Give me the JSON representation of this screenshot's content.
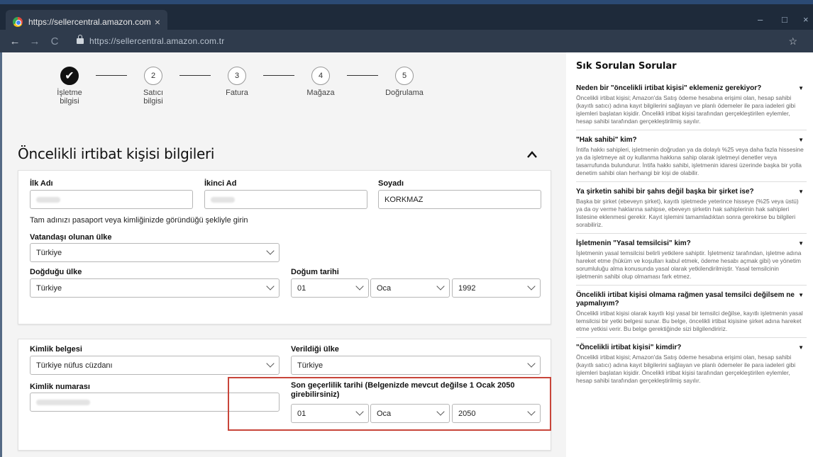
{
  "browser": {
    "tab_title": "https://sellercentral.amazon.com.tr",
    "tab_close": "×",
    "url": "https://sellercentral.amazon.com.tr",
    "minimize": "–",
    "maximize": "□",
    "close": "×",
    "back": "←",
    "forward": "→",
    "reload": "C",
    "bookmark": "☆"
  },
  "stepper": {
    "steps": [
      {
        "num": "✔",
        "label": "İşletme\nbilgisi",
        "state": "done"
      },
      {
        "num": "2",
        "label": "Satıcı\nbilgisi",
        "state": "todo"
      },
      {
        "num": "3",
        "label": "Fatura",
        "state": "todo"
      },
      {
        "num": "4",
        "label": "Mağaza",
        "state": "todo"
      },
      {
        "num": "5",
        "label": "Doğrulama",
        "state": "todo"
      }
    ]
  },
  "section": {
    "title": "Öncelikli irtibat kişisi bilgileri"
  },
  "form": {
    "first_name_label": "İlk Adı",
    "middle_name_label": "İkinci Ad",
    "last_name_label": "Soyadı",
    "last_name_value": "KORKMAZ",
    "name_hint": "Tam adınızı pasaport veya kimliğinizde göründüğü şekliyle girin",
    "citizenship_label": "Vatandaşı olunan ülke",
    "citizenship_value": "Türkiye",
    "birth_country_label": "Doğduğu ülke",
    "birth_country_value": "Türkiye",
    "birth_date_label": "Doğum tarihi",
    "birth_day": "01",
    "birth_month": "Oca",
    "birth_year": "1992",
    "id_doc_label": "Kimlik belgesi",
    "id_doc_value": "Türkiye nüfus cüzdanı",
    "issued_country_label": "Verildiği ülke",
    "issued_country_value": "Türkiye",
    "id_number_label": "Kimlik numarası",
    "expiry_label": "Son geçerlilik tarihi (Belgenizde mevcut değilse 1 Ocak 2050 girebilirsiniz)",
    "expiry_day": "01",
    "expiry_month": "Oca",
    "expiry_year": "2050"
  },
  "faq": {
    "heading": "Sık Sorulan Sorular",
    "items": [
      {
        "q": "Neden bir \"öncelikli irtibat kişisi\" eklemeniz gerekiyor?",
        "a": "Öncelikli irtibat kişisi; Amazon'da Satış ödeme hesabına erişimi olan, hesap sahibi (kayıtlı satıcı) adına kayıt bilgilerini sağlayan ve planlı ödemeler ile para iadeleri gibi işlemleri başlatan kişidir. Öncelikli irtibat kişisi tarafından gerçekleştirilen eylemler, hesap sahibi tarafından gerçekleştirilmiş sayılır."
      },
      {
        "q": "\"Hak sahibi\" kim?",
        "a": "İntifa hakkı sahipleri, işletmenin doğrudan ya da dolaylı %25 veya daha fazla hissesine ya da işletmeye ait oy kullanma hakkına sahip olarak işletmeyi denetler veya tasarrufunda bulundurur. İntifa hakkı sahibi, işletmenin idaresi üzerinde başka bir yolla denetim sahibi olan herhangi bir kişi de olabilir."
      },
      {
        "q": "Ya şirketin sahibi bir şahıs değil başka bir şirket ise?",
        "a": "Başka bir şirket (ebeveyn şirket), kayıtlı işletmede yeterince hisseye (%25 veya üstü) ya da oy verme haklarına sahipse, ebeveyn şirketin hak sahiplerinin hak sahipleri listesine eklenmesi gerekir. Kayıt işlemini tamamladıktan sonra gerekirse bu bilgileri sorabiliriz."
      },
      {
        "q": "İşletmenin \"Yasal temsilcisi\" kim?",
        "a": "İşletmenin yasal temsilcisi belirli yetkilere sahiptir. İşletmeniz tarafından, işletme adına hareket etme (hüküm ve koşulları kabul etmek, ödeme hesabı açmak gibi) ve yönetim sorumluluğu alma konusunda yasal olarak yetkilendirilmiştir. Yasal temsilcinin işletmenin sahibi olup olmaması fark etmez."
      },
      {
        "q": "Öncelikli irtibat kişisi olmama rağmen yasal temsilci değilsem ne yapmalıyım?",
        "a": "Öncelikli irtibat kişisi olarak kayıtlı kişi yasal bir temsilci değilse, kayıtlı işletmenin yasal temsilcisi bir yetki belgesi sunar. Bu belge, öncelikli irtibat kişisine şirket adına hareket etme yetkisi verir. Bu belge gerektiğinde sizi bilgilendiririz."
      },
      {
        "q": "\"Öncelikli irtibat kişisi\" kimdir?",
        "a": "Öncelikli irtibat kişisi; Amazon'da Satış ödeme hesabına erişimi olan, hesap sahibi (kayıtlı satıcı) adına kayıt bilgilerini sağlayan ve planlı ödemeler ile para iadeleri gibi işlemleri başlatan kişidir. Öncelikli irtibat kişisi tarafından gerçekleştirilen eylemler, hesap sahibi tarafından gerçekleştirilmiş sayılır."
      }
    ],
    "toggle_icon": "▼"
  },
  "colors": {
    "highlight": "#c8453a",
    "chrome": "#2f3b4c"
  }
}
